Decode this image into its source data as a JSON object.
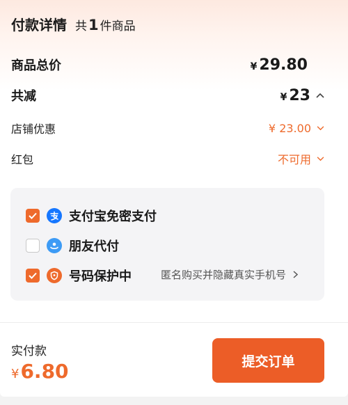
{
  "header": {
    "title": "付款详情",
    "count_prefix": "共",
    "count": "1",
    "count_suffix": "件商品"
  },
  "summary": {
    "total_label": "商品总价",
    "total_currency": "¥",
    "total_value": "29.80",
    "reduce_label": "共减",
    "reduce_currency": "¥",
    "reduce_value": "23",
    "store_discount_label": "店铺优惠",
    "store_discount_value": "¥ 23.00",
    "red_packet_label": "红包",
    "red_packet_value": "不可用"
  },
  "payment_options": [
    {
      "label": "支付宝免密支付",
      "checked": true,
      "icon": "alipay-icon"
    },
    {
      "label": "朋友代付",
      "checked": false,
      "icon": "friend-pay-icon"
    },
    {
      "label": "号码保护中",
      "checked": true,
      "icon": "privacy-shield-icon"
    }
  ],
  "privacy_hint": "匿名购买并隐藏真实手机号",
  "footer": {
    "paid_label": "实付款",
    "paid_currency": "¥",
    "paid_value": "6.80",
    "submit_label": "提交订单"
  },
  "colors": {
    "accent": "#ee6a2c",
    "button": "#ec5d27",
    "alipay": "#1677ff",
    "friend": "#3d9bf5"
  }
}
